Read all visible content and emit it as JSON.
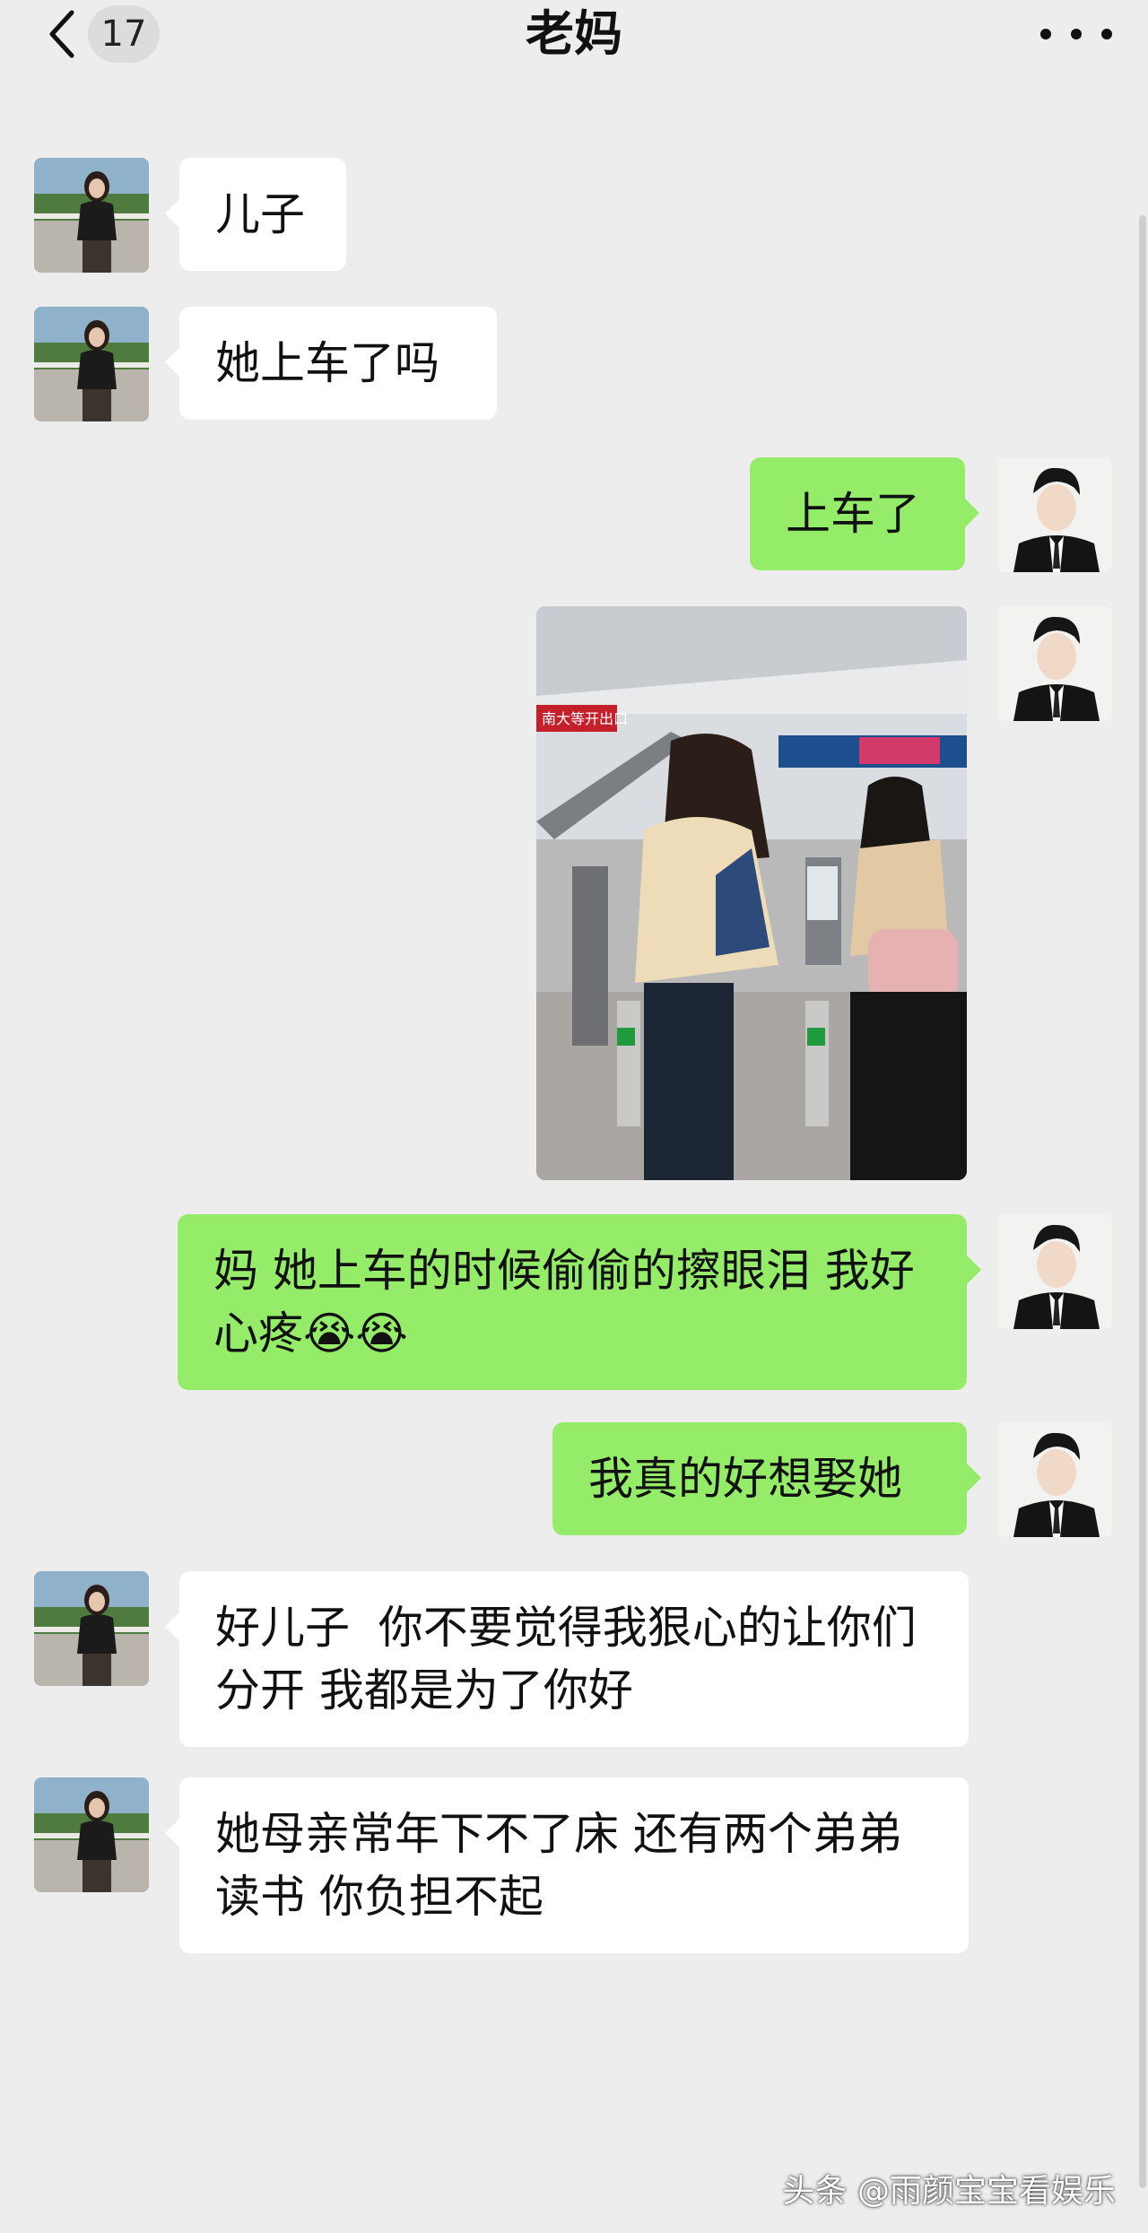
{
  "header": {
    "back_badge": "17",
    "title": "老妈",
    "more_icon": "more-dots-icon"
  },
  "messages": [
    {
      "side": "in",
      "text": "儿子"
    },
    {
      "side": "in",
      "text": "她上车了吗"
    },
    {
      "side": "out",
      "text": "上车了"
    },
    {
      "side": "out",
      "type": "image"
    },
    {
      "side": "out",
      "text": "妈 她上车的时候偷偷的擦眼泪 我好心疼😭😭"
    },
    {
      "side": "out",
      "text": "我真的好想娶她"
    },
    {
      "side": "in",
      "text": "好儿子  你不要觉得我狠心的让你们分开 我都是为了你好"
    },
    {
      "side": "in",
      "text": "她母亲常年下不了床 还有两个弟弟读书 你负担不起"
    }
  ],
  "photo_signs": {
    "left_sign": "南大等开出口",
    "board_text": ""
  },
  "watermark": "头条 @雨颜宝宝看娱乐",
  "colors": {
    "background": "#ededed",
    "bubble_out": "#95ec69",
    "bubble_in": "#ffffff"
  }
}
